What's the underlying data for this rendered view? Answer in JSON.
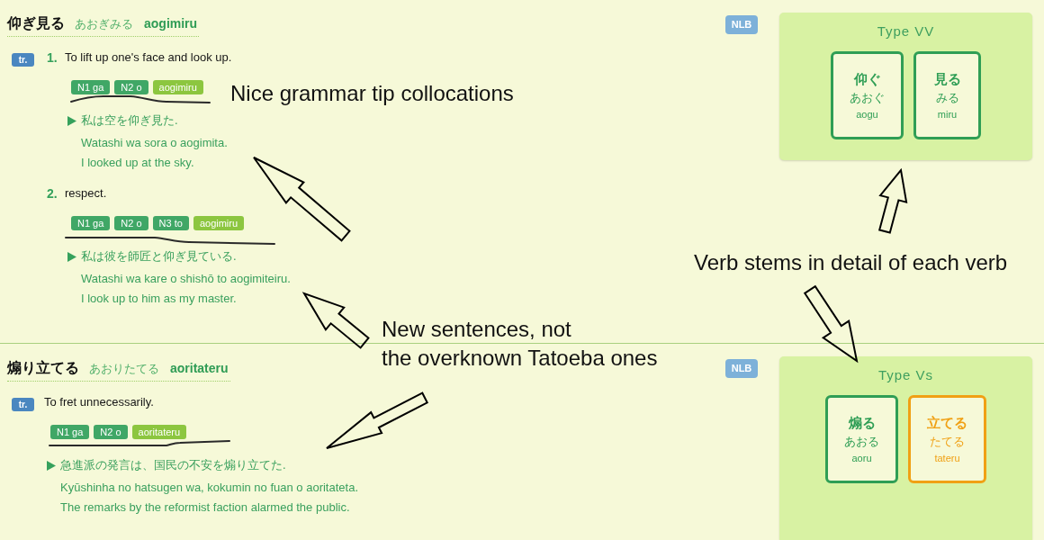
{
  "entries": [
    {
      "headword": "仰ぎ見る",
      "reading": "あおぎみる",
      "romaji": "aogimiru",
      "senses": [
        {
          "pos": "tr.",
          "number": "1.",
          "definition": "To lift up one's face and look up.",
          "collocations": [
            {
              "label": "N1 ga",
              "kind": "argument"
            },
            {
              "label": "N2 o",
              "kind": "argument"
            },
            {
              "label": "aogimiru",
              "kind": "verb"
            }
          ],
          "example": {
            "japanese": "私は空を仰ぎ見た.",
            "romaji": "Watashi wa sora o aogimita.",
            "translation": "I looked up at the sky."
          }
        },
        {
          "number": "2.",
          "definition": "respect.",
          "collocations": [
            {
              "label": "N1 ga",
              "kind": "argument"
            },
            {
              "label": "N2 o",
              "kind": "argument"
            },
            {
              "label": "N3 to",
              "kind": "argument"
            },
            {
              "label": "aogimiru",
              "kind": "verb"
            }
          ],
          "example": {
            "japanese": "私は彼を師匠と仰ぎ見ている.",
            "romaji": "Watashi wa kare o shishō to aogimiteiru.",
            "translation": "I look up to him as my master."
          }
        }
      ],
      "badge": "NLB",
      "verb_type": {
        "title": "Type VV",
        "stems": [
          {
            "kanji": "仰ぐ",
            "kana": "あおぐ",
            "romaji": "aogu",
            "color": "#2f9e55"
          },
          {
            "kanji": "見る",
            "kana": "みる",
            "romaji": "miru",
            "color": "#2f9e55"
          }
        ]
      }
    },
    {
      "headword": "煽り立てる",
      "reading": "あおりたてる",
      "romaji": "aoritateru",
      "senses": [
        {
          "pos": "tr.",
          "definition": "To fret unnecessarily.",
          "collocations": [
            {
              "label": "N1 ga",
              "kind": "argument"
            },
            {
              "label": "N2 o",
              "kind": "argument"
            },
            {
              "label": "aoritateru",
              "kind": "verb"
            }
          ],
          "example": {
            "japanese": "急進派の発言は、国民の不安を煽り立てた.",
            "romaji": "Kyūshinha no hatsugen wa, kokumin no fuan o aoritateta.",
            "translation": "The remarks by the reformist faction alarmed the public."
          }
        }
      ],
      "badge": "NLB",
      "verb_type": {
        "title": "Type Vs",
        "stems": [
          {
            "kanji": "煽る",
            "kana": "あおる",
            "romaji": "aoru",
            "color": "#2f9e55"
          },
          {
            "kanji": "立てる",
            "kana": "たてる",
            "romaji": "tateru",
            "color": "#f0a014"
          }
        ]
      }
    }
  ],
  "annotations": [
    {
      "text": "Nice grammar tip collocations"
    },
    {
      "text": "Verb stems in detail of each verb"
    },
    {
      "text": "New sentences, not\nthe overknown Tatoeba ones"
    }
  ]
}
